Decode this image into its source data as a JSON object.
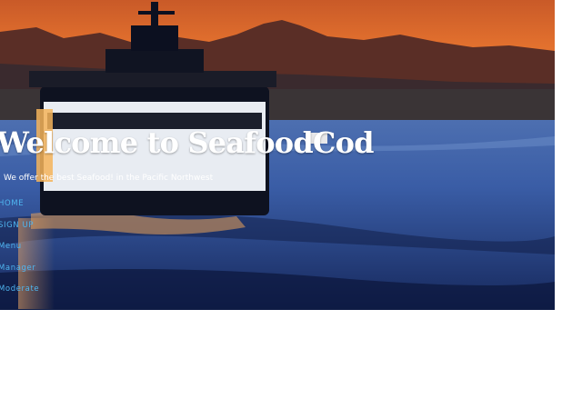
{
  "hero": {
    "title": "Welcome to SeafoodCod",
    "tagline": "We offer the best Seafood! in the Pacific Northwest",
    "image": "ferry-at-sunset-photo"
  },
  "nav": {
    "items": [
      {
        "label": "HOME"
      },
      {
        "label": "SIGN UP"
      },
      {
        "label": "Menu"
      },
      {
        "label": "Manager"
      },
      {
        "label": "Moderate"
      }
    ]
  },
  "colors": {
    "title": "#ffffff",
    "nav_link": "#4fb6f0",
    "page_background": "#ffffff"
  }
}
